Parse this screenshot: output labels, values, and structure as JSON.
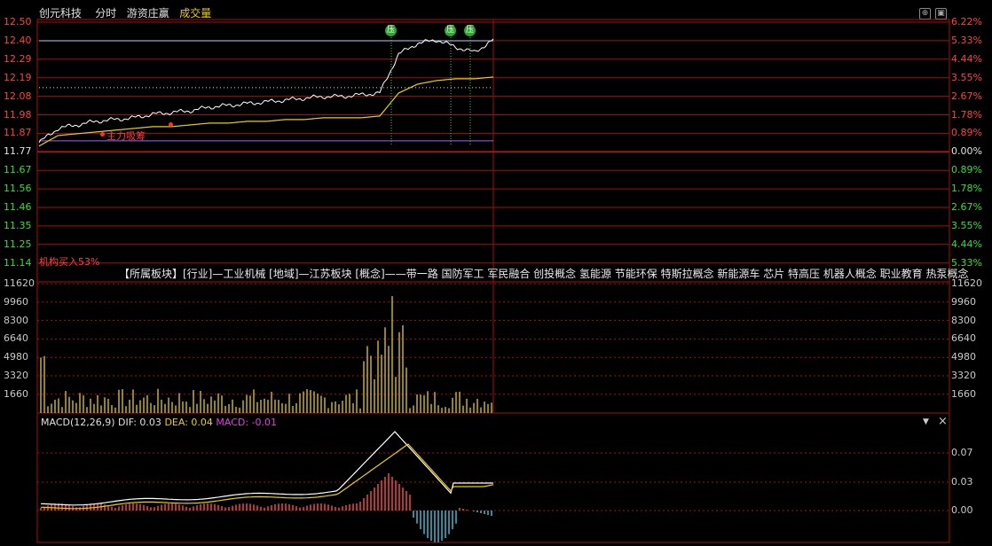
{
  "header": {
    "stock_name": "创元科技",
    "mode_label": "分时",
    "overlay_label": "游资庄赢",
    "volume_label": "成交量",
    "settings_glyph": "⊕",
    "menu_glyph": "▣"
  },
  "price_axis": {
    "left_labels": [
      "12.50",
      "12.40",
      "12.29",
      "12.19",
      "12.08",
      "11.98",
      "11.87",
      "11.77",
      "11.67",
      "11.56",
      "11.46",
      "11.35",
      "11.25",
      "11.14"
    ],
    "right_labels": [
      "6.22%",
      "5.33%",
      "4.44%",
      "3.55%",
      "2.67%",
      "1.78%",
      "0.89%",
      "0.00%",
      "0.89%",
      "1.78%",
      "2.67%",
      "3.55%",
      "4.44%",
      "5.33%"
    ]
  },
  "annotations": {
    "ya_marker": "压",
    "main_force_label": "主力吸筹",
    "institution_label": "机构买入53%"
  },
  "sectors_text": "【所属板块】[行业]—工业机械 [地域]—江苏板块 [概念]——带一路 国防军工 军民融合 创投概念 氢能源 节能环保 特斯拉概念 新能源车 芯片 特高压 机器人概念 职业教育 热泵概念",
  "volume_axis": {
    "labels": [
      "11620",
      "9960",
      "8300",
      "6640",
      "4980",
      "3320",
      "1660"
    ]
  },
  "macd": {
    "label": "MACD(12,26,9)",
    "dif": "DIF: 0.03",
    "dea": "DEA: 0.04",
    "macd": "MACD: -0.01",
    "axis_labels": [
      "0.07",
      "0.03",
      "0.00"
    ],
    "dropdown_glyph": "▼",
    "close_glyph": "×"
  },
  "colors": {
    "grid_red": "#a01010",
    "price_line": "#ffffff",
    "avg_line": "#e8d000",
    "volume_bar": "#d8c000",
    "macd_pos": "#ff5050",
    "macd_neg": "#40c8e0",
    "ya_green": "#2ea52e"
  },
  "chart_data": [
    {
      "type": "line",
      "title": "分时",
      "x": [
        0,
        10,
        20,
        30,
        40,
        50,
        60,
        70,
        80,
        90,
        100,
        110,
        120,
        130,
        140,
        150,
        160,
        170,
        180,
        190,
        200,
        210,
        220,
        230,
        240
      ],
      "series": [
        {
          "values": [
            11.82,
            11.9,
            11.92,
            11.94,
            11.95,
            11.96,
            11.98,
            11.99,
            12.0,
            12.02,
            12.03,
            12.04,
            12.05,
            12.06,
            12.07,
            12.08,
            12.08,
            12.09,
            12.1,
            12.32,
            12.38,
            12.4,
            12.36,
            12.33,
            12.4
          ]
        },
        {
          "values": [
            11.8,
            11.86,
            11.87,
            11.88,
            11.89,
            11.9,
            11.91,
            11.91,
            11.92,
            11.93,
            11.93,
            11.94,
            11.94,
            11.95,
            11.95,
            11.96,
            11.96,
            11.96,
            11.97,
            12.1,
            12.15,
            12.17,
            12.18,
            12.18,
            12.19
          ]
        }
      ],
      "ylim": [
        11.14,
        12.5
      ]
    },
    {
      "type": "bar",
      "title": "成交量",
      "ylim": [
        0,
        11620
      ]
    },
    {
      "type": "line",
      "title": "MACD(12,26,9)",
      "ylim": [
        -0.03,
        0.09
      ]
    }
  ]
}
